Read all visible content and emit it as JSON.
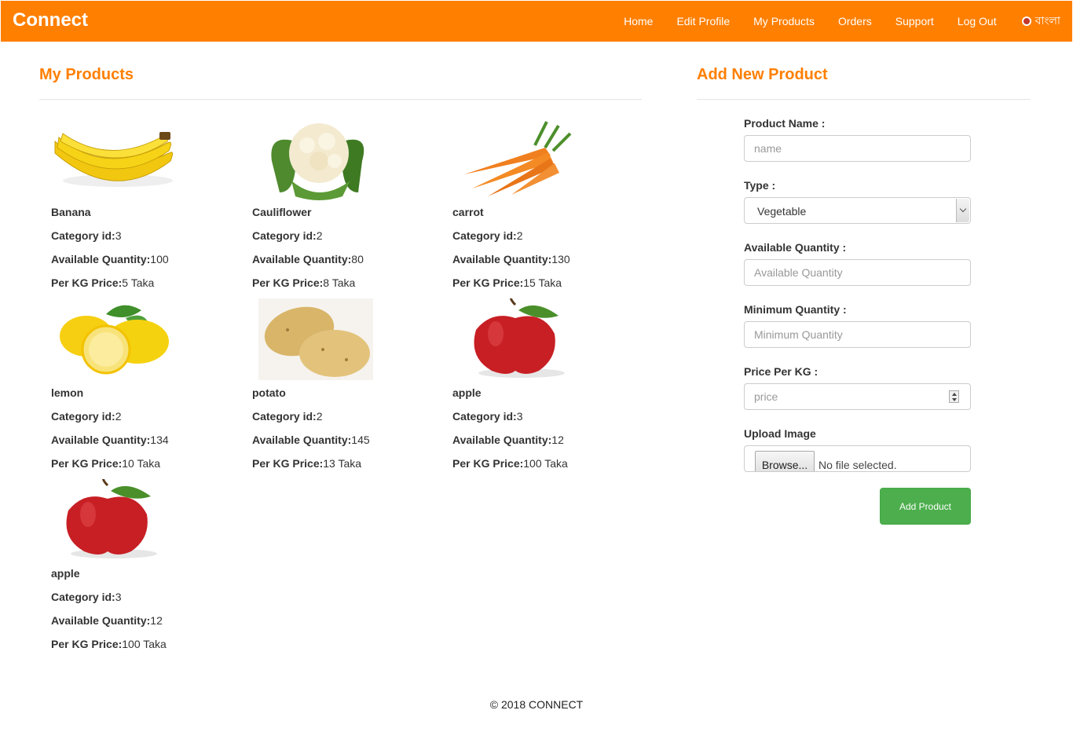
{
  "navbar": {
    "brand": "Connect",
    "links": [
      "Home",
      "Edit Profile",
      "My Products",
      "Orders",
      "Support",
      "Log Out"
    ],
    "language": "বাংলা",
    "color": "#ff7f00"
  },
  "products_section": {
    "title": "My Products",
    "labels": {
      "category": "Category id:",
      "quantity": "Available Quantity:",
      "price": "Per KG Price:"
    },
    "items": [
      {
        "name": "Banana",
        "category_id": "3",
        "quantity": "100",
        "price": "5 Taka",
        "image": "banana-image"
      },
      {
        "name": "Cauliflower",
        "category_id": "2",
        "quantity": "80",
        "price": "8 Taka",
        "image": "cauliflower-image"
      },
      {
        "name": "carrot",
        "category_id": "2",
        "quantity": "130",
        "price": "15 Taka",
        "image": "carrot-image"
      },
      {
        "name": "lemon",
        "category_id": "2",
        "quantity": "134",
        "price": "10 Taka",
        "image": "lemon-image"
      },
      {
        "name": "potato",
        "category_id": "2",
        "quantity": "145",
        "price": "13 Taka",
        "image": "potato-image"
      },
      {
        "name": "apple",
        "category_id": "3",
        "quantity": "12",
        "price": "100 Taka",
        "image": "apple-image"
      },
      {
        "name": "apple",
        "category_id": "3",
        "quantity": "12",
        "price": "100 Taka",
        "image": "apple-image"
      }
    ]
  },
  "add_form": {
    "title": "Add New Product",
    "product_name": {
      "label": "Product Name :",
      "placeholder": "name"
    },
    "type": {
      "label": "Type :",
      "value": "Vegetable"
    },
    "available_quantity": {
      "label": "Available Quantity :",
      "placeholder": "Available Quantity"
    },
    "minimum_quantity": {
      "label": "Minimum Quantity :",
      "placeholder": "Minimum Quantity"
    },
    "price_per_kg": {
      "label": "Price Per KG :",
      "placeholder": "price"
    },
    "upload_image": {
      "label": "Upload Image",
      "button": "Browse...",
      "status": "No file selected."
    },
    "submit": "Add Product",
    "submit_color": "#4cae4c"
  },
  "footer": {
    "text": "© 2018 CONNECT"
  }
}
